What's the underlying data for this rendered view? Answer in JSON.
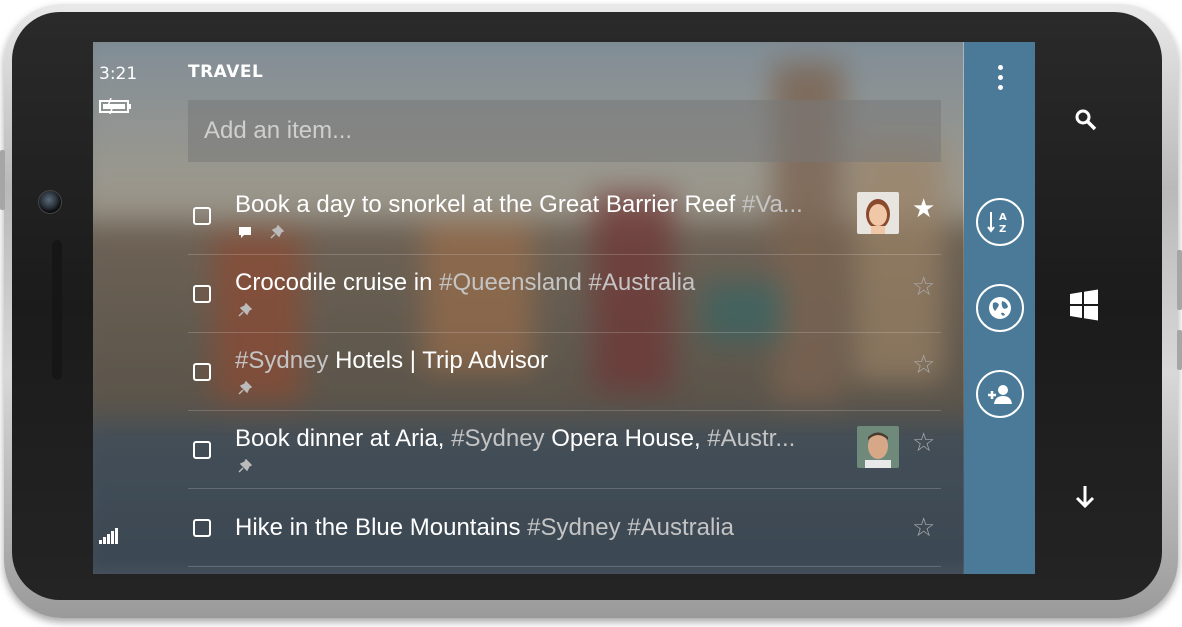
{
  "status": {
    "time": "3:21"
  },
  "list": {
    "title": "TRAVEL",
    "add_placeholder": "Add an item..."
  },
  "tasks": [
    {
      "text": "Book a day to snorkel at the Great Barrier Reef ",
      "tag": "#Va...",
      "has_comment": true,
      "has_pin": true,
      "avatar": "female-avatar",
      "starred": true
    },
    {
      "text": "Crocodile cruise in ",
      "tag": "#Queensland #Australia",
      "has_comment": false,
      "has_pin": true,
      "avatar": null,
      "starred": false
    },
    {
      "text_tag_first": "#Sydney",
      "text": " Hotels | Trip Advisor",
      "has_comment": false,
      "has_pin": true,
      "avatar": null,
      "starred": false
    },
    {
      "text": "Book dinner at Aria, ",
      "tag": "#Sydney",
      "text2": " Opera House, ",
      "tag2": "#Austr...",
      "has_comment": false,
      "has_pin": true,
      "avatar": "male-avatar",
      "starred": false
    },
    {
      "text": "Hike in the Blue Mountains ",
      "tag": "#Sydney #Australia",
      "has_comment": false,
      "has_pin": false,
      "avatar": null,
      "starred": false
    }
  ],
  "app_bar": {
    "sort_label": "A↓Z",
    "colors": {
      "app_bar_bg": "#4b7a98"
    }
  }
}
